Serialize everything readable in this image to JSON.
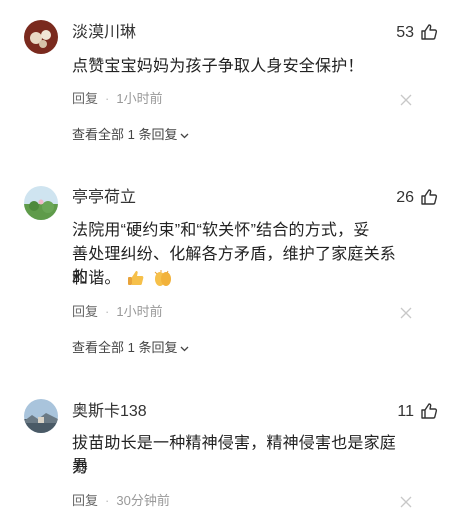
{
  "comments": [
    {
      "username": "淡漠川琳",
      "likes": "53",
      "text": "点赞宝宝妈妈为孩子争取人身安全保护！",
      "reply_label": "回复",
      "time": "1小时前",
      "view_replies": "查看全部 1 条回复"
    },
    {
      "username": "亭亭荷立",
      "likes": "26",
      "text_line1": "法院用“硬约束”和“软关怀”结合的方式，妥",
      "text_line2": "善处理纠纷、化解各方矛盾，维护了家庭关系的",
      "text_line3": "和谐。",
      "reply_label": "回复",
      "time": "1小时前",
      "view_replies": "查看全部 1 条回复"
    },
    {
      "username": "奥斯卡138",
      "likes": "11",
      "text_line1": "拔苗助长是一种精神侵害，精神侵害也是家庭暴",
      "text_line2": "力",
      "reply_label": "回复",
      "time": "30分钟前"
    }
  ],
  "icons": {
    "like": "thumbs-up-icon",
    "close": "close-icon",
    "expand": "chevron-down-icon",
    "emoji": "thumbs-up-emoji",
    "clap": "clap-emoji"
  },
  "colors": {
    "text": "#222222",
    "meta": "#999999",
    "background": "#ffffff"
  }
}
